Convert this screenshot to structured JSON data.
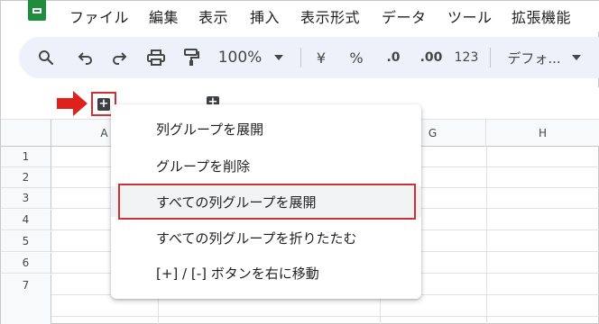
{
  "menubar": {
    "items": [
      "ファイル",
      "編集",
      "表示",
      "挿入",
      "表示形式",
      "データ",
      "ツール",
      "拡張機能"
    ]
  },
  "toolbar": {
    "zoom": "100%",
    "currency": "¥",
    "percent": "%",
    "decrease_decimal": ".0",
    "increase_decimal": ".00",
    "number_format": "123",
    "font": "デフォ..."
  },
  "grid": {
    "columns": [
      "A",
      "G",
      "H"
    ],
    "rows": [
      "1",
      "2",
      "3",
      "4",
      "5",
      "6",
      "7"
    ]
  },
  "context_menu": {
    "items": [
      "列グループを展開",
      "グループを削除",
      "すべての列グループを展開",
      "すべての列グループを折りたたむ",
      "[+] / [-] ボタンを右に移動"
    ],
    "highlighted_index": 2
  },
  "colors": {
    "toolbar_bg": "#edf2fa",
    "annotation_red": "#d32f2f",
    "sheets_green": "#1e8e3e"
  },
  "icons": {
    "group_toggle": "plus-icon"
  }
}
